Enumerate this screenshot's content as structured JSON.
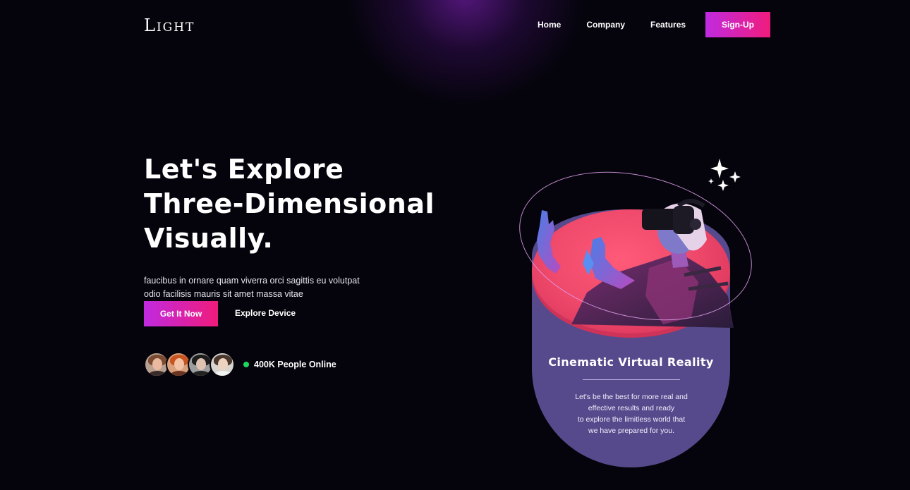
{
  "header": {
    "logo": "Light",
    "nav": [
      "Home",
      "Company",
      "Features"
    ],
    "signup_label": "Sign-Up"
  },
  "hero": {
    "title_lines": [
      "Let's Explore",
      "Three-Dimensional",
      "Visually."
    ],
    "description_lines": [
      "faucibus in ornare quam viverra orci sagittis eu volutpat",
      "odio facilisis mauris sit amet massa vitae"
    ],
    "primary_button": "Get It Now",
    "secondary_link": "Explore Device",
    "online_text": "400K People Online"
  },
  "card": {
    "title": "Cinematic Virtual Reality",
    "text_lines": [
      "Let's be the best for more real and",
      "effective results and ready",
      "to explore the limitless world that",
      "we have prepared for you."
    ]
  },
  "colors": {
    "background": "#05040c",
    "gradient_start": "#c02ae0",
    "gradient_end": "#f01c7c",
    "card_purple": "#574a8c",
    "card_pink": "#f04a6c",
    "online_green": "#1ed760"
  }
}
